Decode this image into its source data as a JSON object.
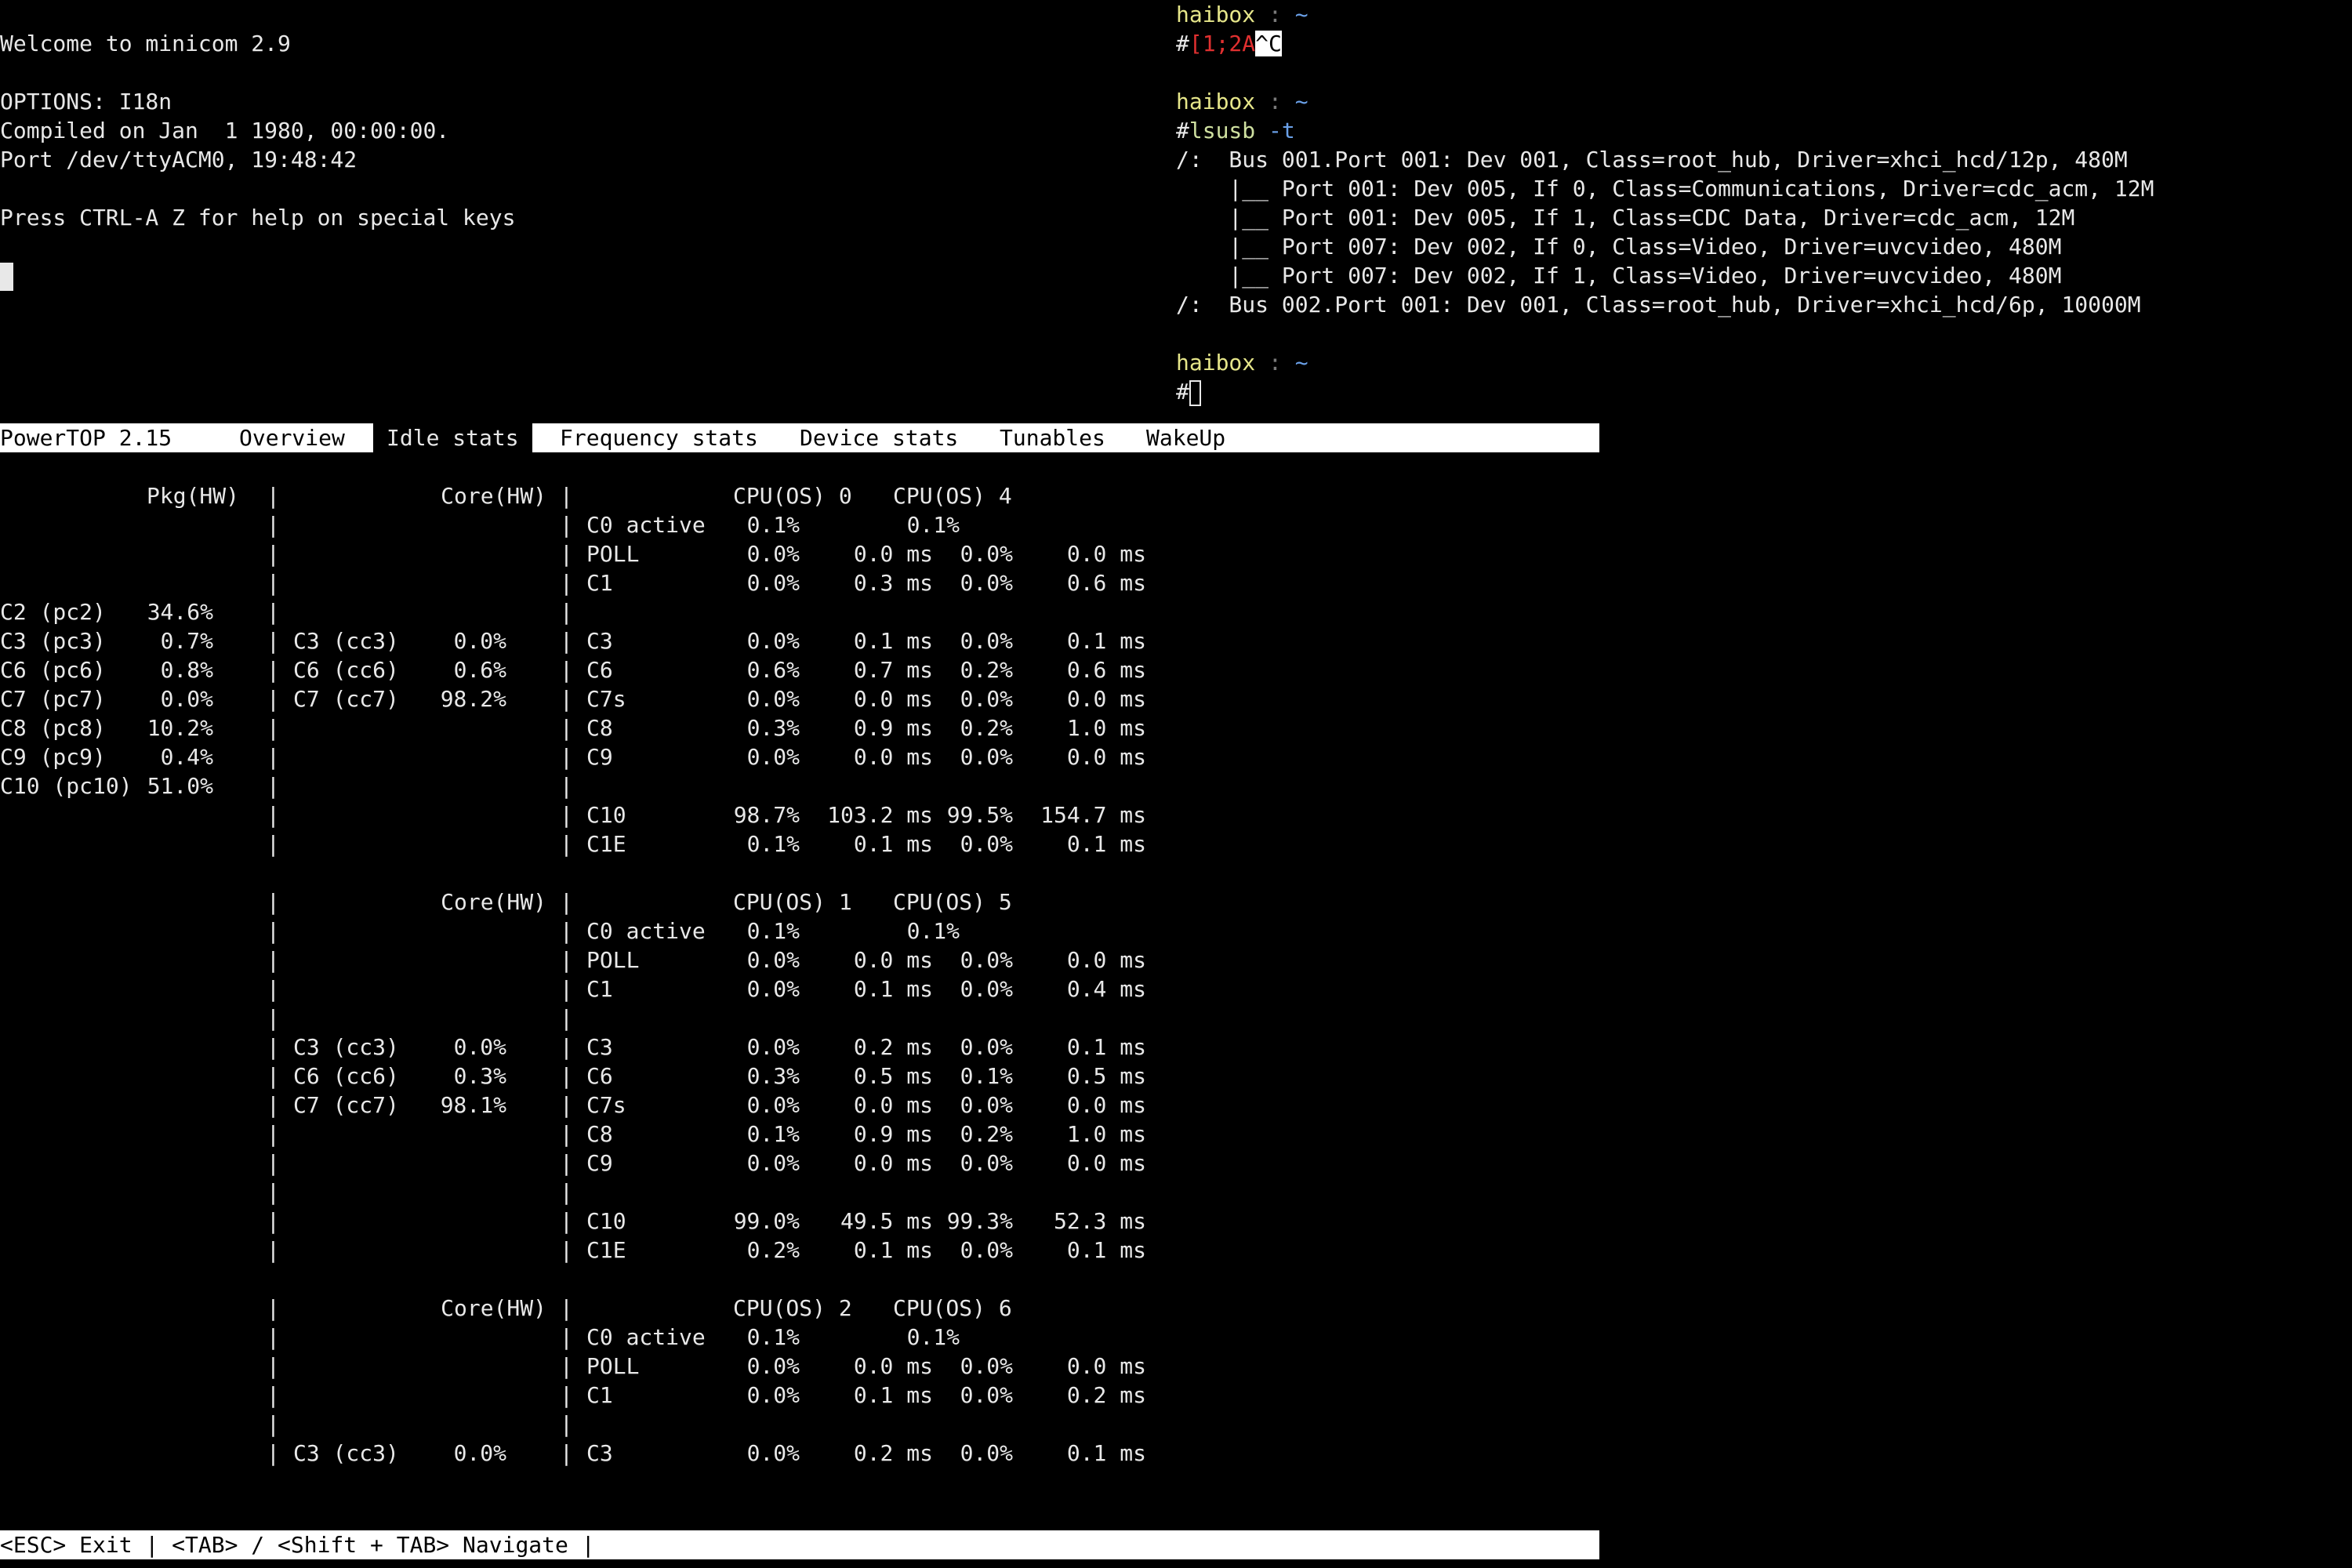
{
  "minicom": {
    "welcome": "Welcome to minicom 2.9",
    "options": "OPTIONS: I18n",
    "compiled": "Compiled on Jan  1 1980, 00:00:00.",
    "port": "Port /dev/ttyACM0, 19:48:42",
    "help": "Press CTRL-A Z for help on special keys"
  },
  "shell": {
    "host": "haibox",
    "sep": ":",
    "dir": "~",
    "prompt_symbol": "#",
    "escape_seq": "[1;2A",
    "ctrl_c": "^C",
    "command": "lsusb",
    "command_flag": "-t",
    "output": [
      "/:  Bus 001.Port 001: Dev 001, Class=root_hub, Driver=xhci_hcd/12p, 480M",
      "    |__ Port 001: Dev 005, If 0, Class=Communications, Driver=cdc_acm, 12M",
      "    |__ Port 001: Dev 005, If 1, Class=CDC Data, Driver=cdc_acm, 12M",
      "    |__ Port 007: Dev 002, If 0, Class=Video, Driver=uvcvideo, 480M",
      "    |__ Port 007: Dev 002, If 1, Class=Video, Driver=uvcvideo, 480M",
      "/:  Bus 002.Port 001: Dev 001, Class=root_hub, Driver=xhci_hcd/6p, 10000M"
    ]
  },
  "powertop": {
    "tabs": [
      "PowerTOP 2.15",
      "Overview",
      "Idle stats",
      "Frequency stats",
      "Device stats",
      "Tunables",
      "WakeUp"
    ],
    "active_tab": "Idle stats",
    "pkg_header": "Pkg(HW)",
    "pkg_rows": [
      {
        "state": "C2 (pc2)",
        "value": "34.6%"
      },
      {
        "state": "C3 (pc3)",
        "value": "0.7%"
      },
      {
        "state": "C6 (pc6)",
        "value": "0.8%"
      },
      {
        "state": "C7 (pc7)",
        "value": "0.0%"
      },
      {
        "state": "C8 (pc8)",
        "value": "10.2%"
      },
      {
        "state": "C9 (pc9)",
        "value": "0.4%"
      },
      {
        "state": "C10 (pc10)",
        "value": "51.0%"
      }
    ],
    "core_header": "Core(HW)",
    "cpu_label": "CPU(OS)",
    "blocks": [
      {
        "cpus": [
          "0",
          "4"
        ],
        "core": [
          [
            "C3 (cc3)",
            "0.0%"
          ],
          [
            "C6 (cc6)",
            "0.6%"
          ],
          [
            "C7 (cc7)",
            "98.2%"
          ]
        ],
        "c0": [
          "C0 active",
          "0.1%",
          "0.1%"
        ],
        "states": [
          [
            "POLL",
            "0.0%",
            "0.0 ms",
            "0.0%",
            "0.0 ms"
          ],
          [
            "C1",
            "0.0%",
            "0.3 ms",
            "0.0%",
            "0.6 ms"
          ],
          null,
          [
            "C3",
            "0.0%",
            "0.1 ms",
            "0.0%",
            "0.1 ms"
          ],
          [
            "C6",
            "0.6%",
            "0.7 ms",
            "0.2%",
            "0.6 ms"
          ],
          [
            "C7s",
            "0.0%",
            "0.0 ms",
            "0.0%",
            "0.0 ms"
          ],
          [
            "C8",
            "0.3%",
            "0.9 ms",
            "0.2%",
            "1.0 ms"
          ],
          [
            "C9",
            "0.0%",
            "0.0 ms",
            "0.0%",
            "0.0 ms"
          ],
          null,
          [
            "C10",
            "98.7%",
            "103.2 ms",
            "99.5%",
            "154.7 ms"
          ],
          [
            "C1E",
            "0.1%",
            "0.1 ms",
            "0.0%",
            "0.1 ms"
          ]
        ]
      },
      {
        "cpus": [
          "1",
          "5"
        ],
        "core": [
          [
            "C3 (cc3)",
            "0.0%"
          ],
          [
            "C6 (cc6)",
            "0.3%"
          ],
          [
            "C7 (cc7)",
            "98.1%"
          ]
        ],
        "c0": [
          "C0 active",
          "0.1%",
          "0.1%"
        ],
        "states": [
          [
            "POLL",
            "0.0%",
            "0.0 ms",
            "0.0%",
            "0.0 ms"
          ],
          [
            "C1",
            "0.0%",
            "0.1 ms",
            "0.0%",
            "0.4 ms"
          ],
          null,
          [
            "C3",
            "0.0%",
            "0.2 ms",
            "0.0%",
            "0.1 ms"
          ],
          [
            "C6",
            "0.3%",
            "0.5 ms",
            "0.1%",
            "0.5 ms"
          ],
          [
            "C7s",
            "0.0%",
            "0.0 ms",
            "0.0%",
            "0.0 ms"
          ],
          [
            "C8",
            "0.1%",
            "0.9 ms",
            "0.2%",
            "1.0 ms"
          ],
          [
            "C9",
            "0.0%",
            "0.0 ms",
            "0.0%",
            "0.0 ms"
          ],
          null,
          [
            "C10",
            "99.0%",
            "49.5 ms",
            "99.3%",
            "52.3 ms"
          ],
          [
            "C1E",
            "0.2%",
            "0.1 ms",
            "0.0%",
            "0.1 ms"
          ]
        ]
      },
      {
        "cpus": [
          "2",
          "6"
        ],
        "core": [
          [
            "C3 (cc3)",
            "0.0%"
          ]
        ],
        "c0": [
          "C0 active",
          "0.1%",
          "0.1%"
        ],
        "states": [
          [
            "POLL",
            "0.0%",
            "0.0 ms",
            "0.0%",
            "0.0 ms"
          ],
          [
            "C1",
            "0.0%",
            "0.1 ms",
            "0.0%",
            "0.2 ms"
          ],
          null,
          [
            "C3",
            "0.0%",
            "0.2 ms",
            "0.0%",
            "0.1 ms"
          ]
        ]
      }
    ],
    "footer": "<ESC> Exit | <TAB> / <Shift + TAB> Navigate |"
  }
}
